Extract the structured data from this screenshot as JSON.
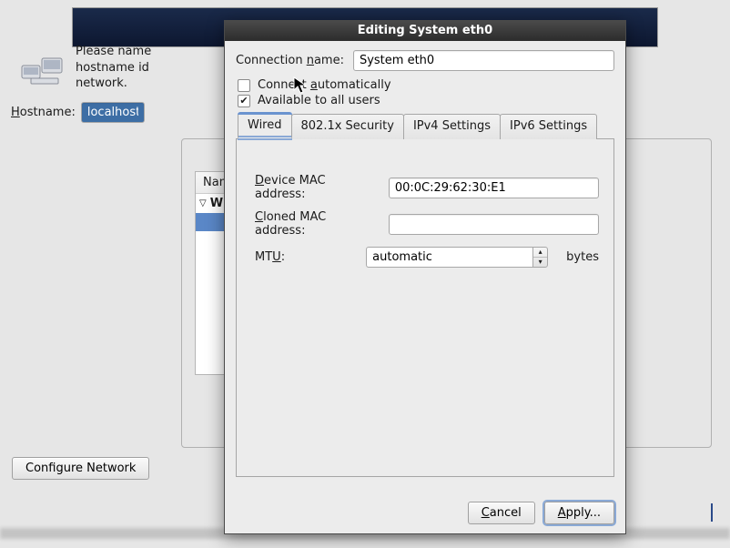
{
  "background": {
    "desc_line1": "Please name",
    "desc_line2": "hostname id",
    "desc_line3": "network.",
    "hostname_label_pre": "",
    "hostname_label_ul": "H",
    "hostname_label_post": "ostname:",
    "hostname_value": "localhost.l",
    "conn_list_header_name": "Nam",
    "conn_group_label": "W",
    "configure_btn": "Configure Network"
  },
  "dialog": {
    "title": "Editing System eth0",
    "conn_name_label_pre": "Connection ",
    "conn_name_label_ul": "n",
    "conn_name_label_post": "ame:",
    "conn_name_value": "System eth0",
    "chk_connect_auto_pre": "Connect ",
    "chk_connect_auto_ul": "a",
    "chk_connect_auto_post": "utomatically",
    "chk_connect_auto_checked": false,
    "chk_all_users": "Available to all users",
    "chk_all_users_checked": true,
    "tabs": {
      "wired": "Wired",
      "security": "802.1x Security",
      "ipv4": "IPv4 Settings",
      "ipv6": "IPv6 Settings"
    },
    "wired": {
      "device_mac_label_ul": "D",
      "device_mac_label_post": "evice MAC address:",
      "device_mac_value": "00:0C:29:62:30:E1",
      "cloned_mac_label_ul": "C",
      "cloned_mac_label_post": "loned MAC address:",
      "cloned_mac_value": "",
      "mtu_label_pre": "MT",
      "mtu_label_ul": "U",
      "mtu_label_post": ":",
      "mtu_value": "automatic",
      "mtu_suffix": "bytes"
    },
    "cancel_ul": "C",
    "cancel_post": "ancel",
    "apply_ul": "A",
    "apply_post": "pply..."
  }
}
